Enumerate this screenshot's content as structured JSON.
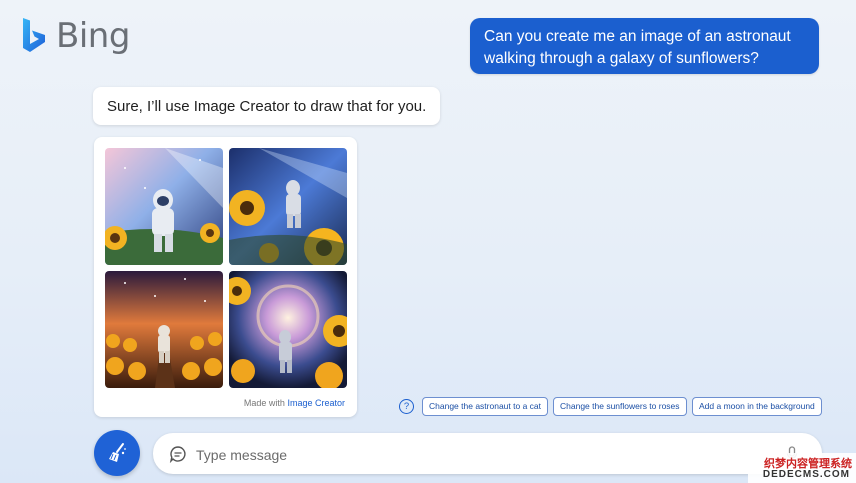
{
  "brand": {
    "name": "Bing",
    "icon": "bing-logo-icon",
    "color": "#1b5fcf"
  },
  "conversation": {
    "user_message": "Can you create me an image of an astronaut walking through a galaxy of sunflowers?",
    "bot_message": "Sure, I’ll use Image Creator to draw that for you.",
    "image_card": {
      "images": [
        {
          "alt": "astronaut in pink galaxy among sunflowers"
        },
        {
          "alt": "astronaut walking in blue galaxy with sunflowers"
        },
        {
          "alt": "astronaut on path through sunflower field under starry sky"
        },
        {
          "alt": "astronaut under swirling galaxy framed by sunflowers"
        }
      ],
      "credit_prefix": "Made with",
      "credit_link": "Image Creator"
    }
  },
  "suggestions": {
    "help_icon": "question-circle-icon",
    "chips": [
      "Change the astronaut to a cat",
      "Change the sunflowers to roses",
      "Add a moon in the background"
    ]
  },
  "composer": {
    "new_topic_icon": "broom-icon",
    "chat_icon": "chat-bubble-icon",
    "placeholder": "Type message",
    "mic_icon": "microphone-icon"
  },
  "watermark": {
    "line1": "织梦内容管理系统",
    "line2": "DEDECMS.COM"
  }
}
